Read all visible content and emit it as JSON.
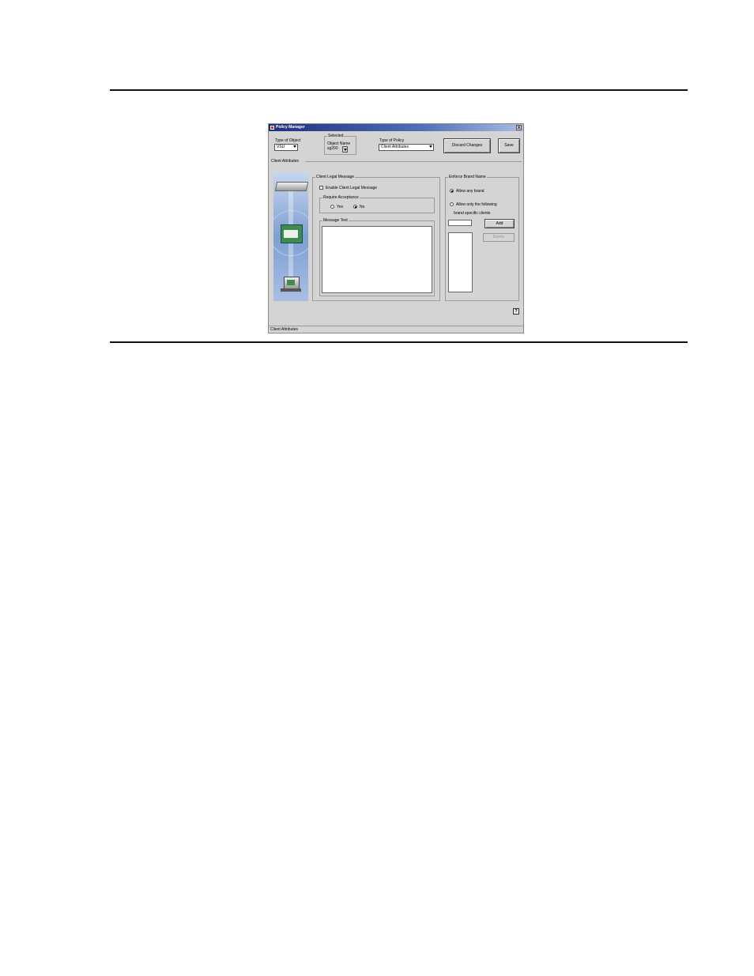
{
  "window": {
    "title": "Policy Manager",
    "close": "x"
  },
  "toolbar": {
    "type_of_object_label": "Type of Object",
    "type_of_object_value": "VSU",
    "selected_label": "Selected",
    "object_name_label": "Object Name",
    "object_name_value": "sg200",
    "type_of_policy_label": "Type of Policy",
    "type_of_policy_value": "Client Attributes",
    "discard_label": "Discard Changes",
    "save_label": "Save"
  },
  "section_title": "Client Attributes",
  "legal_message": {
    "group_label": "Client Legal Message",
    "enable_label": "Enable Client Legal Message",
    "enable_checked": false,
    "acceptance_label": "Require Acceptance",
    "yes_label": "Yes",
    "no_label": "No",
    "selected": "No",
    "message_text_label": "Message Text",
    "message_text_value": ""
  },
  "brand": {
    "group_label": "Enforce Brand Name",
    "allow_any_label": "Allow any brand",
    "allow_only_label": "Allow only the following",
    "specific_label": "brand specific clients",
    "selected": "Allow any brand",
    "input_value": "",
    "add_label": "Add",
    "delete_label": "Delete",
    "list_items": []
  },
  "help_label": "?",
  "status_bar": "Client Attributes",
  "icons": [
    "server-icon",
    "certificate-icon",
    "computer-icon"
  ]
}
